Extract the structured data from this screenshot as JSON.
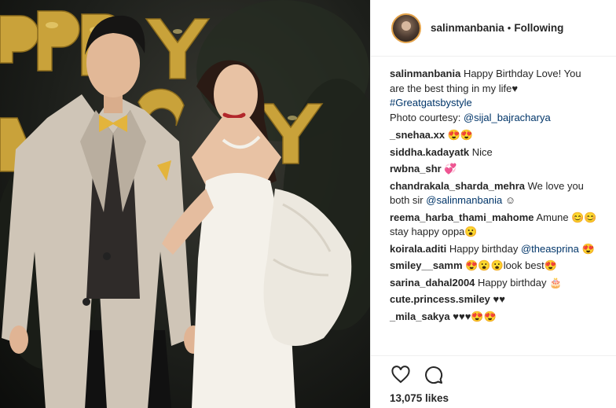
{
  "post": {
    "photo_icon": "portrait-photo",
    "header": {
      "username": "salinmanbania",
      "separator": "•",
      "follow_label": "Following"
    },
    "caption": {
      "username": "salinmanbania",
      "text_1": "Happy Birthday Love! You are the best thing in my life♥",
      "hashtag": "#Greatgatsbystyle",
      "text_2": "Photo courtesy: ",
      "mention": "@sijal_bajracharya"
    },
    "comments": [
      {
        "username": "_snehaa.xx",
        "text": "😍😍"
      },
      {
        "username": "siddha.kadayatk",
        "text": "Nice"
      },
      {
        "username": "rwbna_shr",
        "text": "💞"
      },
      {
        "username": "chandrakala_sharda_mehra",
        "text": "We love you both sir ",
        "mention": "@salinmanbania",
        "after": " ☺"
      },
      {
        "username": "reema_harba_thami_mahome",
        "text": "Amune 😊😊 stay happy oppa😮"
      },
      {
        "username": "koirala.aditi",
        "text": "Happy birthday ",
        "mention": "@theasprina",
        "after": " 😍"
      },
      {
        "username": "smiley__samm",
        "text": "😍😮😮look best😍"
      },
      {
        "username": "sarina_dahal2004",
        "text": "Happy birthday 🎂"
      },
      {
        "username": "cute.princess.smiley",
        "text": "♥♥"
      },
      {
        "username": "_mila_sakya",
        "text": "♥♥♥😍😍"
      }
    ],
    "actions": {
      "like_icon": "heart-icon",
      "comment_icon": "speech-bubble-icon"
    },
    "likes": "13,075 likes"
  }
}
